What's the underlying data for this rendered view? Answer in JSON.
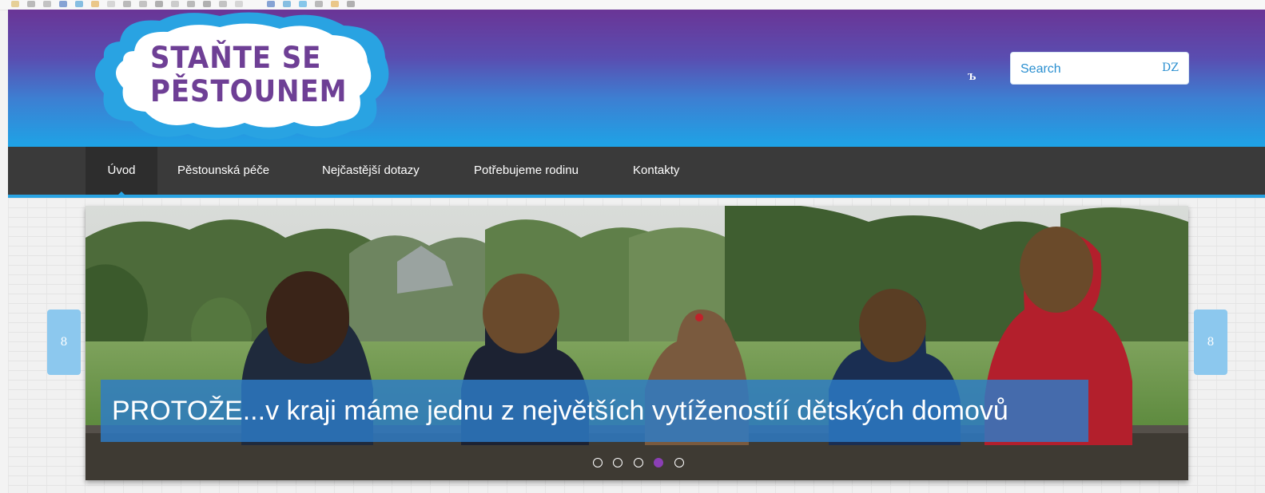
{
  "logo": {
    "line1": "STAŇTE SE",
    "line2": "PĚSTOUNEM"
  },
  "header": {
    "search_toggle": "Ъ"
  },
  "search": {
    "placeholder": "Search",
    "button_glyph": "DZ"
  },
  "nav": {
    "items": [
      {
        "label": "Úvod",
        "active": true
      },
      {
        "label": "Pěstounská péče",
        "active": false
      },
      {
        "label": "Nejčastější dotazy",
        "active": false
      },
      {
        "label": "Potřebujeme rodinu",
        "active": false
      },
      {
        "label": "Kontakty",
        "active": false
      }
    ]
  },
  "slider": {
    "caption": "PROTOŽE...v kraji máme jednu z největších vytíženostíí dětských domovů",
    "prev_glyph": "8",
    "next_glyph": "8",
    "dot_count": 5,
    "active_dot": 4
  },
  "colors": {
    "header_top": "#6a3596",
    "header_bottom": "#1ea3e6",
    "brand_purple": "#6e3f95",
    "accent_blue": "#29a3e2",
    "active_dot": "#8b3fb5",
    "nav_bg": "#3a3a3a"
  }
}
